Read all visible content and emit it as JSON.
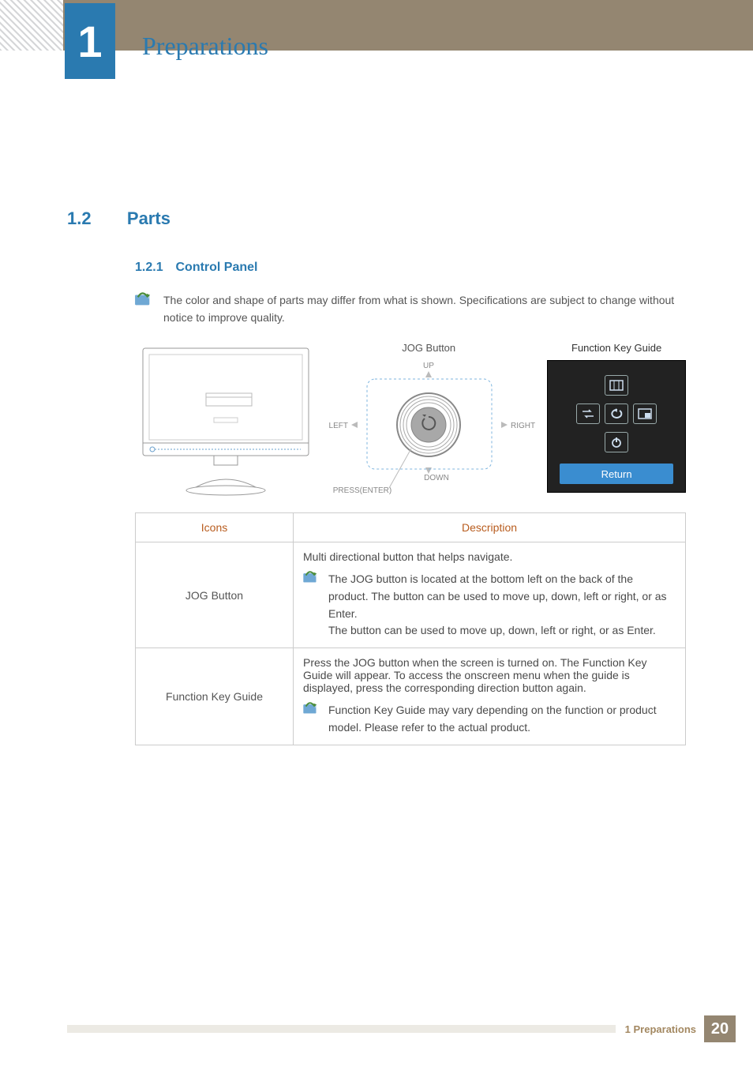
{
  "chapter": {
    "number": "1",
    "title": "Preparations"
  },
  "section": {
    "number": "1.2",
    "title": "Parts"
  },
  "subsection": {
    "number": "1.2.1",
    "title": "Control Panel"
  },
  "notices": {
    "top": "The color and shape of parts may differ from what is shown. Specifications are subject to change without notice to improve quality."
  },
  "diagram": {
    "jog_label": "JOG Button",
    "up": "UP",
    "down": "DOWN",
    "left": "LEFT",
    "right": "RIGHT",
    "press": "PRESS(ENTER)",
    "fkg_label": "Function Key Guide",
    "return": "Return"
  },
  "table": {
    "headers": {
      "icons": "Icons",
      "description": "Description"
    },
    "rows": [
      {
        "icon": "JOG Button",
        "desc": "Multi directional button that helps navigate.",
        "note": "The JOG button is located at the bottom left on the back of the product. The button can be used to move up, down, left or right, or as Enter.\nThe button can be used to move up, down, left or right, or as Enter."
      },
      {
        "icon": "Function Key Guide",
        "desc": "Press the JOG button when the screen is turned on. The Function Key Guide will appear. To access the onscreen menu when the guide is displayed, press the corresponding direction button again.",
        "note": "Function Key Guide may vary depending on the function or product model. Please refer to the actual product."
      }
    ]
  },
  "footer": {
    "section": "1 Preparations",
    "page": "20"
  }
}
